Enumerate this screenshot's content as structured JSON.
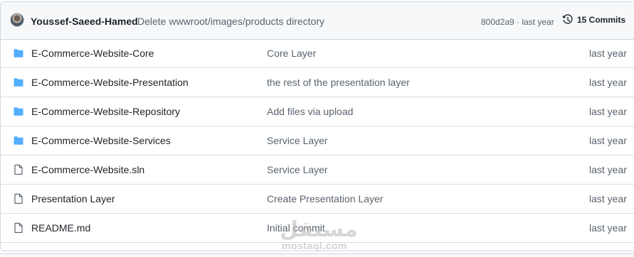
{
  "last_commit": {
    "author": "Youssef-Saeed-Hamed",
    "message": "Delete wwwroot/images/products directory",
    "sha_time": "800d2a9 · last year",
    "commits_label": "15 Commits"
  },
  "files": [
    {
      "type": "folder",
      "name": "E-Commerce-Website-Core",
      "message": "Core Layer",
      "age": "last year"
    },
    {
      "type": "folder",
      "name": "E-Commerce-Website-Presentation",
      "message": "the rest of the presentation layer",
      "age": "last year"
    },
    {
      "type": "folder",
      "name": "E-Commerce-Website-Repository",
      "message": "Add files via upload",
      "age": "last year"
    },
    {
      "type": "folder",
      "name": "E-Commerce-Website-Services",
      "message": "Service Layer",
      "age": "last year"
    },
    {
      "type": "file",
      "name": "E-Commerce-Website.sln",
      "message": "Service Layer",
      "age": "last year"
    },
    {
      "type": "file",
      "name": "Presentation Layer",
      "message": "Create Presentation Layer",
      "age": "last year"
    },
    {
      "type": "file",
      "name": "README.md",
      "message": "Initial commit",
      "age": "last year"
    }
  ],
  "watermark": {
    "arabic": "مستقل",
    "latin": "mostaql.com"
  },
  "colors": {
    "folder": "#54aeff",
    "file": "#59636e",
    "border": "#d0d7de",
    "header_bg": "#f6f8fa"
  }
}
